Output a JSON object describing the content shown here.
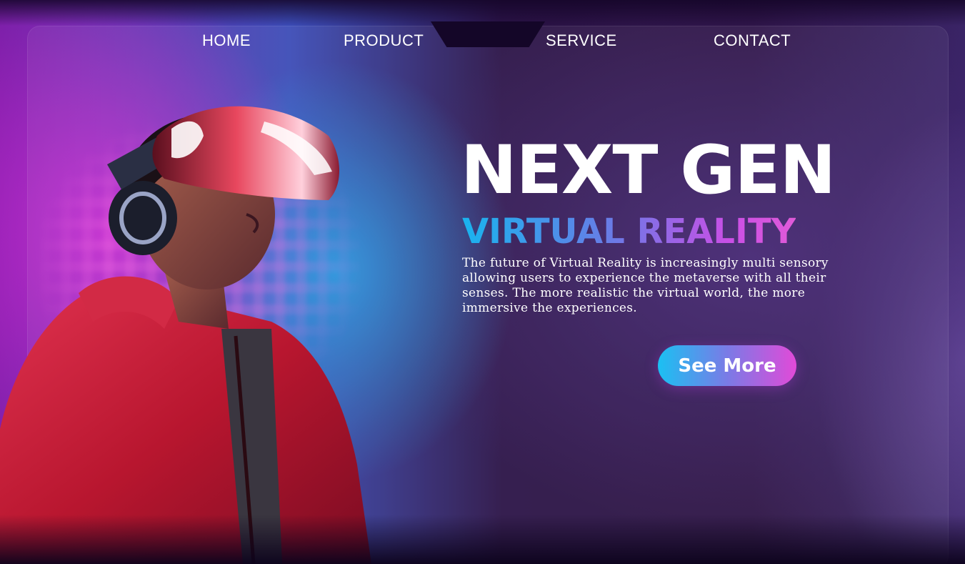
{
  "nav": {
    "items": [
      {
        "label": "HOME"
      },
      {
        "label": "PRODUCT"
      },
      {
        "label": "SERVICE"
      },
      {
        "label": "CONTACT"
      }
    ]
  },
  "hero": {
    "headline": "NEXT GEN",
    "subheadline": "VIRTUAL REALITY",
    "description": "The future of Virtual Reality is increasingly multi sensory allowing users to experience the metaverse with all their senses. The more realistic the virtual world, the more immersive the experiences.",
    "cta_label": "See More",
    "image_icon": "vr-headset-person-illustration"
  },
  "colors": {
    "accent_cyan": "#1bc0f2",
    "accent_magenta": "#e14ad8",
    "jacket_red": "#c8203c",
    "background_dark": "#2a1140"
  }
}
